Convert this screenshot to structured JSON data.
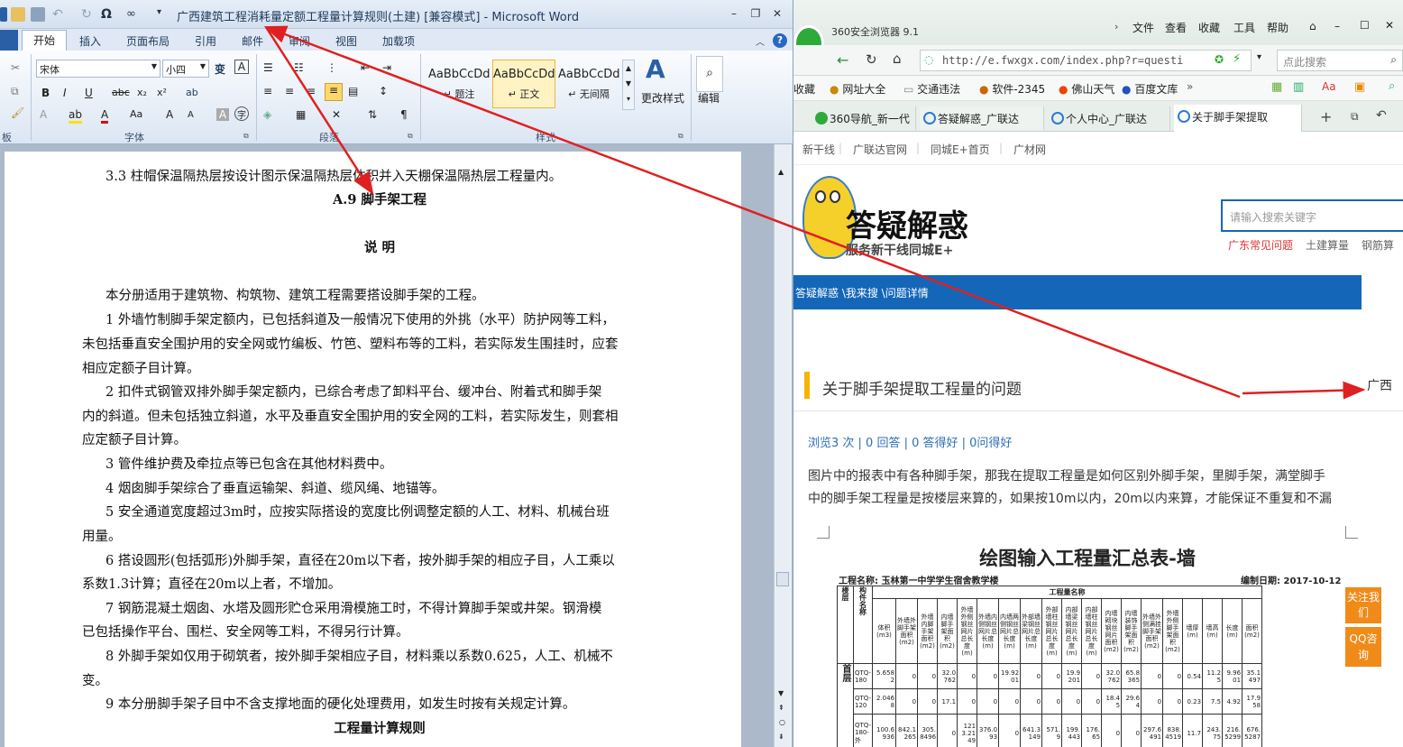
{
  "word": {
    "title": "广西建筑工程消耗量定额工程量计算规则(土建) [兼容模式] - Microsoft Word",
    "tabs": [
      "开始",
      "插入",
      "页面布局",
      "引用",
      "邮件",
      "审阅",
      "视图",
      "加载项"
    ],
    "font_name": "宋体",
    "font_size": "小四",
    "groups": {
      "clipboard": "板",
      "font": "字体",
      "paragraph": "段落",
      "styles": "样式"
    },
    "styles": [
      {
        "sample": "AaBbCcDd",
        "name": "题注"
      },
      {
        "sample": "AaBbCcDd",
        "name": "正文"
      },
      {
        "sample": "AaBbCcDd",
        "name": "无间隔"
      }
    ],
    "change_styles": "更改样式",
    "edit": "编辑",
    "doc": [
      "3.3  柱帽保温隔热层按设计图示保温隔热层体积并入天棚保温隔热层工程量内。",
      "A.9  脚手架工程",
      "说    明",
      "本分册适用于建筑物、构筑物、建筑工程需要搭设脚手架的工程。",
      "1  外墙竹制脚手架定额内，已包括斜道及一般情况下使用的外挑（水平）防护网等工料，",
      "未包括垂直安全围护用的安全网或竹编板、竹笆、塑料布等的工料，若实际发生围挂时，应套",
      "相应定额子目计算。",
      "2  扣件式钢管双排外脚手架定额内，已综合考虑了卸料平台、缓冲台、附着式和脚手架",
      "内的斜道。但未包括独立斜道，水平及垂直安全围护用的安全网的工料，若实际发生，则套相",
      "应定额子目计算。",
      "3  管件维护费及牵拉点等已包含在其他材料费中。",
      "4  烟囱脚手架综合了垂直运输架、斜道、缆风绳、地锚等。",
      "5  安全通道宽度超过3m时，应按实际搭设的宽度比例调整定额的人工、材料、机械台班",
      "用量。",
      "6  搭设圆形(包括弧形)外脚手架，直径在20m以下者，按外脚手架的相应子目，人工乘以",
      "系数1.3计算；直径在20m以上者，不增加。",
      "7  钢筋混凝土烟囱、水塔及圆形贮仓采用滑模施工时，不得计算脚手架或井架。钢滑模",
      "已包括操作平台、围栏、安全网等工料，不得另行计算。",
      "8  外脚手架如仅用于砌筑者，按外脚手架相应子目，材料乘以系数0.625，人工、机械不",
      "变。",
      "9  本分册脚手架子目中不含支撑地面的硬化处理费用，如发生时按有关规定计算。",
      "工程量计算规则"
    ]
  },
  "browser": {
    "app": "360安全浏览器 9.1",
    "menu": [
      "文件",
      "查看",
      "收藏",
      "工具",
      "帮助"
    ],
    "url": "http://e.fwxgx.com/index.php?r=questi",
    "search_placeholder": "点此搜索",
    "favorites": [
      "收藏",
      "网址大全",
      "交通违法",
      "软件-2345",
      "佛山天气",
      "百度文库"
    ],
    "tabs": [
      "360导航_新一代",
      "答疑解惑_广联达",
      "个人中心_广联达",
      "关于脚手架提取"
    ],
    "topnav": [
      "新干线",
      "广联达官网",
      "同城E+首页",
      "广材网"
    ],
    "logo_title": "答疑解惑",
    "logo_sub": "服务新干线同城E+",
    "site_search_placeholder": "请输入搜索关键字",
    "hot": [
      "广东常见问题",
      "土建算量",
      "钢筋算"
    ],
    "breadcrumb": "答疑解惑 \\我来搜 \\问题详情",
    "question_title": "关于脚手架提取工程量的问题",
    "region": "广西",
    "stats": "浏览3 次 | 0 回答 | 0 答得好 | 0问得好",
    "body1": "图片中的报表中有各种脚手架，那我在提取工程量是如何区别外脚手架，里脚手架，满堂脚手",
    "body2": "中的脚手架工程量是按楼层来算的，如果按10m以内，20m以内来算，才能保证不重复和不漏",
    "float_btns": [
      "关注我们",
      "QQ咨询"
    ],
    "report": {
      "title": "绘图输入工程量汇总表-墙",
      "project": "工程名称: 玉林第一中学学生宿舍教学楼",
      "date": "编制日期: 2017-10-12",
      "group_header": "工程量名称",
      "row_header": "楼层",
      "member": "构件名称",
      "columns": [
        "体积(m3)",
        "外墙外脚手架面积(m2)",
        "外墙内脚手架面积(m2)",
        "内墙脚手架面积(m2)",
        "外墙外侧钢丝网片总长度(m)",
        "外墙内侧钢丝网片总长度(m)",
        "内墙两侧钢丝网片总长度(m)",
        "外部墙梁钢丝网片总长度(m)",
        "外部墙柱钢丝网片总长度(m)",
        "内部墙梁钢丝网片总长度(m)",
        "内部墙柱钢丝网片总长度(m)",
        "内墙砌块钢丝网片面积(m2)",
        "内墙装饰脚手架面积(m2)",
        "外墙外侧满挂脚手架面积(m2)",
        "外墙外侧脚手架面积(m2)",
        "墙厚(m)",
        "墙高(m)",
        "长度(m)",
        "面积(m2)"
      ],
      "floor": "首层",
      "rows": [
        {
          "name": "QTQ-180",
          "v": [
            "5.6582",
            "0",
            "0",
            "32.0762",
            "0",
            "0",
            "19.9201",
            "0",
            "0",
            "19.9201",
            "0",
            "32.0762",
            "65.8365",
            "0",
            "0",
            "0.54",
            "11.25",
            "9.9601",
            "35.1497"
          ]
        },
        {
          "name": "QTQ-120",
          "v": [
            "2.0468",
            "0",
            "0",
            "17.1",
            "0",
            "0",
            "0",
            "0",
            "0",
            "0",
            "0",
            "18.45",
            "29.64",
            "0",
            "0",
            "0.23",
            "7.5",
            "4.92",
            "17.958"
          ]
        },
        {
          "name": "QTQ-180-外",
          "v": [
            "100.6936",
            "842.1265",
            "305.8496",
            "0",
            "1213.2149",
            "376.093",
            "0",
            "641.3149",
            "571.9",
            "199.443",
            "176.65",
            "0",
            "0",
            "297.6491",
            "838.4519",
            "11.7",
            "243.75",
            "216.5299",
            "676.5287"
          ]
        }
      ]
    }
  },
  "colors": {
    "word_tab_bg": "#dfe8f4",
    "browser_nav_blue": "#1466b8",
    "arrow_red": "#e02020",
    "float_orange": "#f08a18"
  }
}
